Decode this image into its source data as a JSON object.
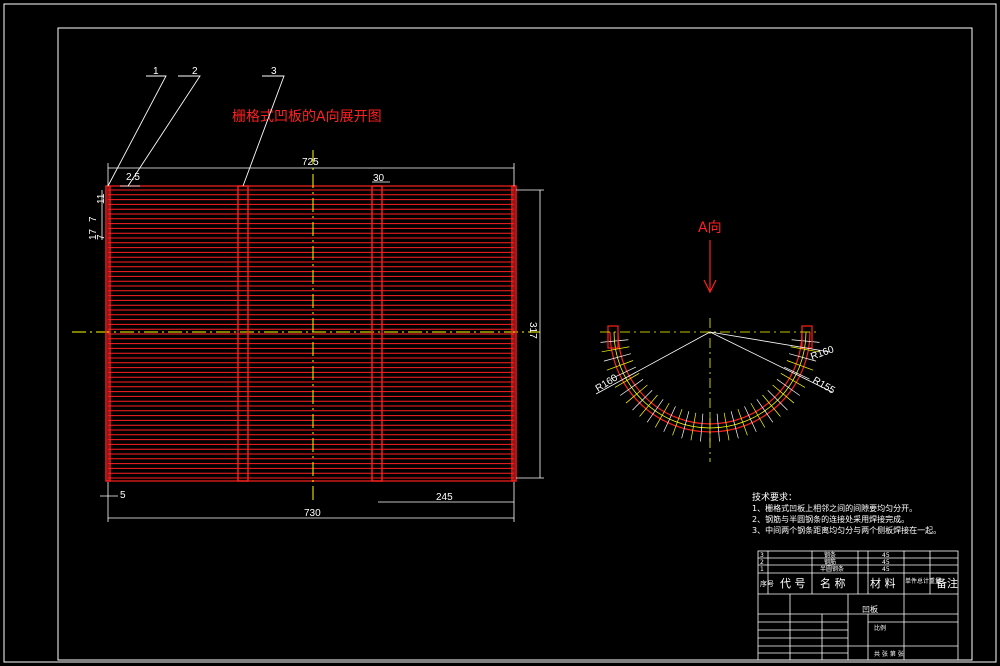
{
  "drawing": {
    "title": "栅格式凹板的A向展开图",
    "view_label": "A向",
    "balloons": [
      "1",
      "2",
      "3"
    ],
    "dims": {
      "top_overall": "725",
      "bottom_overall": "730",
      "bar_width": "30",
      "pitch": "2.5",
      "right_height": "317",
      "bottom_left": "5",
      "bottom_right": "245",
      "left_a": "7",
      "left_b": "11",
      "left_c": "17",
      "left_d": "7",
      "r_left": "R160",
      "r_right_a": "R160",
      "r_right_b": "R155"
    }
  },
  "notes": {
    "heading": "技术要求：",
    "lines": [
      "1、栅格式凹板上相邻之间的间隙要均匀分开。",
      "2、钢筋与半圆钢条的连接处采用焊接完成。",
      "3、中间两个钢条距离均匀分与两个侧板焊接在一起。"
    ]
  },
  "title_block": {
    "parts": [
      {
        "no": "3",
        "name": "钢条",
        "qty": "",
        "material": "45"
      },
      {
        "no": "2",
        "name": "钢筋",
        "qty": "",
        "material": "45"
      },
      {
        "no": "1",
        "name": "半圆钢条",
        "qty": "",
        "material": "45"
      }
    ],
    "header": {
      "no": "序号",
      "code": "代  号",
      "name": "名  称",
      "material": "材  料",
      "qty_note": "单件总计重量",
      "remark": "备注"
    },
    "drawing_name": "凹板",
    "scale_label": "比例",
    "sheet": "共 张 第 张"
  }
}
